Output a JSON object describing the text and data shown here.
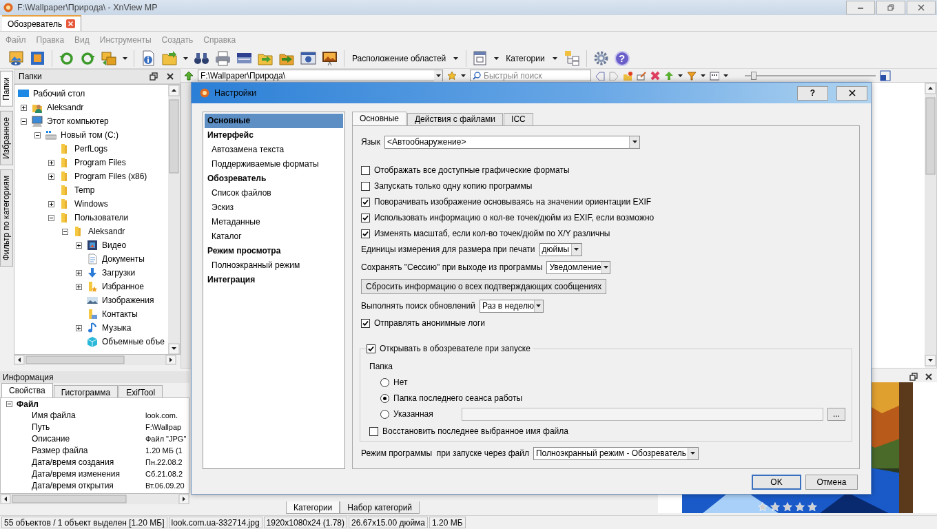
{
  "window": {
    "title": "F:\\Wallpaper\\Природа\\ - XnView MP"
  },
  "tabs": [
    {
      "label": "Обозреватель",
      "selected": true
    }
  ],
  "menu": [
    {
      "label": "Файл",
      "disabled": true
    },
    {
      "label": "Правка",
      "disabled": true
    },
    {
      "label": "Вид",
      "disabled": true
    },
    {
      "label": "Инструменты",
      "disabled": true
    },
    {
      "label": "Создать",
      "disabled": true
    },
    {
      "label": "Справка",
      "disabled": true
    }
  ],
  "toolbar": {
    "layout_button": "Расположение областей",
    "categories_button": "Категории",
    "help_button": "?"
  },
  "side_tabs": [
    {
      "label": "Папки",
      "selected": true
    },
    {
      "label": "Избранное",
      "selected": false
    },
    {
      "label": "Фильтр по категориям",
      "selected": false
    }
  ],
  "folders": {
    "title": "Папки",
    "tree": [
      {
        "label": "Рабочий стол",
        "kind": "desktop",
        "children": [
          {
            "label": "Aleksandr",
            "kind": "user",
            "expanded": false
          },
          {
            "label": "Этот компьютер",
            "kind": "computer",
            "expanded": true,
            "children": [
              {
                "label": "Новый том (C:)",
                "kind": "drive",
                "expanded": true,
                "children": [
                  {
                    "label": "PerfLogs",
                    "kind": "folder"
                  },
                  {
                    "label": "Program Files",
                    "kind": "folder",
                    "expanded": false
                  },
                  {
                    "label": "Program Files (x86)",
                    "kind": "folder",
                    "expanded": false
                  },
                  {
                    "label": "Temp",
                    "kind": "folder"
                  },
                  {
                    "label": "Windows",
                    "kind": "folder",
                    "expanded": false
                  },
                  {
                    "label": "Пользователи",
                    "kind": "folder",
                    "expanded": true,
                    "children": [
                      {
                        "label": "Aleksandr",
                        "kind": "folder",
                        "expanded": true,
                        "children": [
                          {
                            "label": "Видео",
                            "kind": "video",
                            "expanded": false
                          },
                          {
                            "label": "Документы",
                            "kind": "docs"
                          },
                          {
                            "label": "Загрузки",
                            "kind": "download",
                            "expanded": false
                          },
                          {
                            "label": "Избранное",
                            "kind": "favorites",
                            "expanded": false
                          },
                          {
                            "label": "Изображения",
                            "kind": "images"
                          },
                          {
                            "label": "Контакты",
                            "kind": "contacts"
                          },
                          {
                            "label": "Музыка",
                            "kind": "music",
                            "expanded": false
                          },
                          {
                            "label": "Объемные объе",
                            "kind": "cube"
                          }
                        ]
                      }
                    ]
                  }
                ]
              }
            ]
          }
        ]
      }
    ]
  },
  "address_bar": {
    "value": "F:\\Wallpaper\\Природа\\"
  },
  "search": {
    "placeholder": "Быстрый поиск"
  },
  "thumbnail_size": {
    "level": 0.05
  },
  "info": {
    "title": "Информация",
    "tabs": [
      {
        "label": "Свойства",
        "selected": true
      },
      {
        "label": "Гистограмма",
        "selected": false
      },
      {
        "label": "ExifTool",
        "selected": false
      }
    ],
    "group": {
      "label": "Файл",
      "expanded": true,
      "rows": [
        {
          "name": "Имя файла",
          "value": "look.com."
        },
        {
          "name": "Путь",
          "value": "F:\\Wallpap"
        },
        {
          "name": "Описание",
          "value": "Файл \"JPG\""
        },
        {
          "name": "Размер файла",
          "value": "1.20 МБ (1"
        },
        {
          "name": "Дата/время создания",
          "value": "Пн.22.08.2"
        },
        {
          "name": "Дата/время изменения",
          "value": "Сб.21.08.2"
        },
        {
          "name": "Дата/время открытия",
          "value": "Вт.06.09.20"
        }
      ]
    }
  },
  "bottom_tabs": [
    {
      "label": "Категории",
      "selected": true
    },
    {
      "label": "Набор категорий",
      "selected": false
    }
  ],
  "preview": {
    "stars": 0
  },
  "status_bar": [
    "55 объектов / 1 объект выделен [1.20 МБ]",
    "look.com.ua-332714.jpg",
    "1920x1080x24 (1.78)",
    "26.67x15.00 дюйма",
    "1.20 МБ"
  ],
  "dialog": {
    "title": "Настройки",
    "help_button": "?",
    "nav": [
      {
        "label": "Основные",
        "kind": "section",
        "selected": true
      },
      {
        "label": "Интерфейс",
        "kind": "section",
        "selected": false
      },
      {
        "label": "Автозамена текста",
        "kind": "page",
        "selected": false
      },
      {
        "label": "Поддерживаемые форматы",
        "kind": "page",
        "selected": false
      },
      {
        "label": "Обозреватель",
        "kind": "section",
        "selected": false
      },
      {
        "label": "Список файлов",
        "kind": "page",
        "selected": false
      },
      {
        "label": "Эскиз",
        "kind": "page",
        "selected": false
      },
      {
        "label": "Метаданные",
        "kind": "page",
        "selected": false
      },
      {
        "label": "Каталог",
        "kind": "page",
        "selected": false
      },
      {
        "label": "Режим просмотра",
        "kind": "section",
        "selected": false
      },
      {
        "label": "Полноэкранный режим",
        "kind": "page",
        "selected": false
      },
      {
        "label": "Интеграция",
        "kind": "section",
        "selected": false
      }
    ],
    "tabs": [
      {
        "label": "Основные",
        "selected": true
      },
      {
        "label": "Действия с файлами",
        "selected": false
      },
      {
        "label": "ICC",
        "selected": false
      }
    ],
    "language": {
      "label": "Язык",
      "value": "<Автообнаружение>"
    },
    "options": [
      {
        "kind": "checkbox",
        "label": "Отображать все доступные графические форматы",
        "checked": false
      },
      {
        "kind": "checkbox",
        "label": "Запускать только одну копию программы",
        "checked": false
      },
      {
        "kind": "checkbox",
        "label": "Поворачивать изображение основываясь на значении ориентации EXIF",
        "checked": true
      },
      {
        "kind": "checkbox",
        "label": "Использовать информацию о кол-ве точек/дюйм из EXIF, если возможно",
        "checked": true
      },
      {
        "kind": "checkbox",
        "label": "Изменять масштаб, если кол-во точек/дюйм по X/Y различны",
        "checked": true
      },
      {
        "kind": "combo",
        "label": "Единицы измерения для размера при печати",
        "value": "дюймы"
      },
      {
        "kind": "combo",
        "label": "Сохранять \"Сессию\" при выходе из программы",
        "value": "Уведомление"
      },
      {
        "kind": "button",
        "label": "Сбросить информацию о всех подтверждающих сообщениях"
      },
      {
        "kind": "combo",
        "label": "Выполнять поиск обновлений",
        "value": "Раз в неделю"
      },
      {
        "kind": "checkbox",
        "label": "Отправлять анонимные логи",
        "checked": true
      }
    ],
    "startup": {
      "label": "Открывать в обозревателе при запуске",
      "checked": true,
      "folder_label": "Папка",
      "choices": [
        {
          "label": "Нет",
          "selected": false
        },
        {
          "label": "Папка последнего сеанса работы",
          "selected": true
        },
        {
          "label": "Указанная",
          "selected": false
        }
      ],
      "browse_button": "...",
      "restore": {
        "label": "Восстановить последнее выбранное имя файла",
        "checked": false
      }
    },
    "file_mode": {
      "label": "Режим программы  при запуске через файл",
      "value": "Полноэкранный режим - Обозреватель"
    },
    "buttons": [
      {
        "label": "OK",
        "default": true
      },
      {
        "label": "Отмена",
        "default": false
      }
    ]
  }
}
